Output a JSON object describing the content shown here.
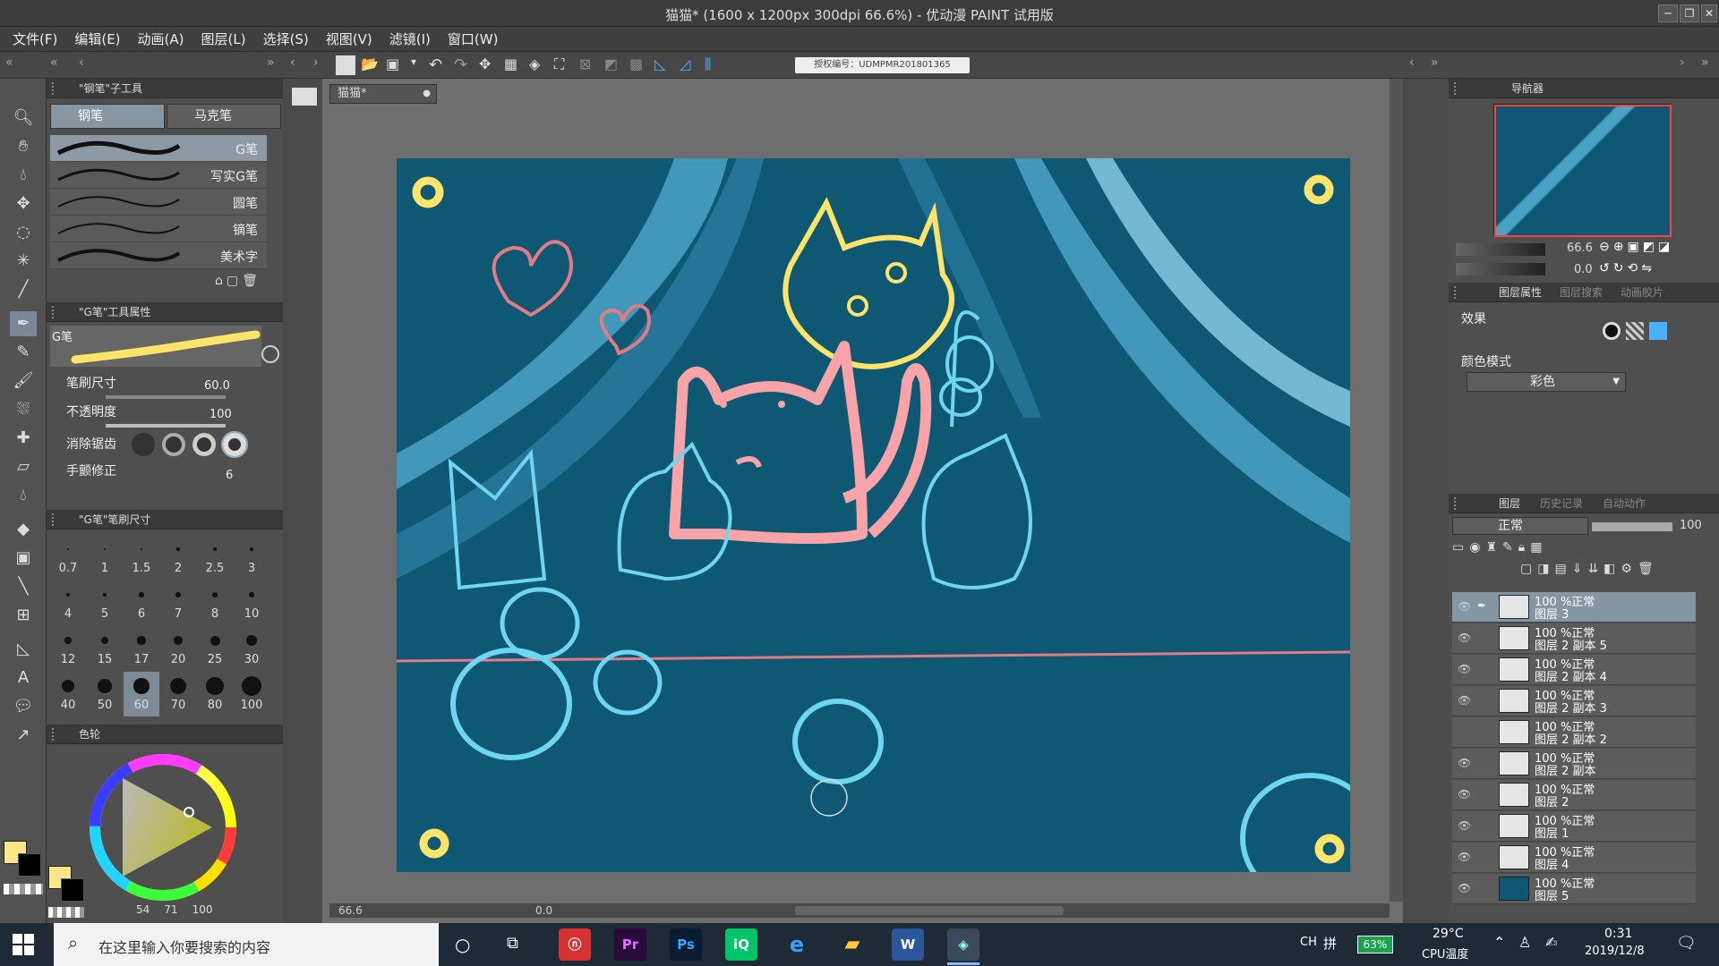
{
  "window": {
    "title": "猫猫* (1600 x 1200px 300dpi 66.6%) - 优动漫 PAINT 试用版"
  },
  "menu": [
    {
      "label": "文件(F)"
    },
    {
      "label": "编辑(E)"
    },
    {
      "label": "动画(A)"
    },
    {
      "label": "图层(L)"
    },
    {
      "label": "选择(S)"
    },
    {
      "label": "视图(V)"
    },
    {
      "label": "滤镜(I)"
    },
    {
      "label": "窗口(W)"
    }
  ],
  "license": "授权编号：UDMPMR201801365",
  "canvas_tab": "猫猫*",
  "subtool_panel": {
    "title": "\"钢笔\"子工具",
    "tabs": [
      "钢笔",
      "马克笔"
    ],
    "brushes": [
      "G笔",
      "写实G笔",
      "圆笔",
      "镝笔",
      "美术字"
    ]
  },
  "tool_props": {
    "title": "\"G笔\"工具属性",
    "brush_name": "G笔",
    "brush_size_label": "笔刷尺寸",
    "brush_size_value": "60.0",
    "opacity_label": "不透明度",
    "opacity_value": "100",
    "antialias_label": "消除锯齿",
    "stabilize_label": "手颤修正",
    "stabilize_value": "6"
  },
  "brush_size_panel": {
    "title": "\"G笔\"笔刷尺寸",
    "sizes": [
      "0.7",
      "1",
      "1.5",
      "2",
      "2.5",
      "3",
      "4",
      "5",
      "6",
      "7",
      "8",
      "10",
      "12",
      "15",
      "17",
      "20",
      "25",
      "30",
      "40",
      "50",
      "60",
      "70",
      "80",
      "100"
    ]
  },
  "color_panel": {
    "title": "色轮",
    "h": "54",
    "s": "71",
    "v": "100"
  },
  "status": {
    "zoom": "66.6",
    "angle": "0.0"
  },
  "navigator": {
    "title": "导航器",
    "zoom": "66.6",
    "angle": "0.0"
  },
  "layer_props": {
    "tab1": "图层属性",
    "tab2": "图层搜索",
    "tab3": "动画胶片",
    "effect_label": "效果",
    "color_mode_label": "颜色模式",
    "color_mode_value": "彩色"
  },
  "layers_panel": {
    "tab1": "图层",
    "tab2": "历史记录",
    "tab3": "自动动作",
    "blend_mode": "正常",
    "opacity": "100",
    "layers": [
      {
        "pct": "100 %正常",
        "name": "图层 3"
      },
      {
        "pct": "100 %正常",
        "name": "图层 2 副本 5"
      },
      {
        "pct": "100 %正常",
        "name": "图层 2 副本 4"
      },
      {
        "pct": "100 %正常",
        "name": "图层 2 副本 3"
      },
      {
        "pct": "100 %正常",
        "name": "图层 2 副本 2"
      },
      {
        "pct": "100 %正常",
        "name": "图层 2 副本"
      },
      {
        "pct": "100 %正常",
        "name": "图层 2"
      },
      {
        "pct": "100 %正常",
        "name": "图层 1"
      },
      {
        "pct": "100 %正常",
        "name": "图层 4"
      },
      {
        "pct": "100 %正常",
        "name": "图层 5"
      }
    ]
  },
  "taskbar": {
    "search_placeholder": "在这里输入你要搜索的内容",
    "ime1": "CH",
    "ime2": "拼",
    "battery": "63%",
    "temp": "29°C",
    "temp_label": "CPU温度",
    "time": "0:31",
    "date": "2019/12/8"
  },
  "colors": {
    "canvas_bg": "#0e5874",
    "accent_yellow": "#ffe46a",
    "pink": "#f7a3a8",
    "cyan": "#6fd6f0"
  }
}
